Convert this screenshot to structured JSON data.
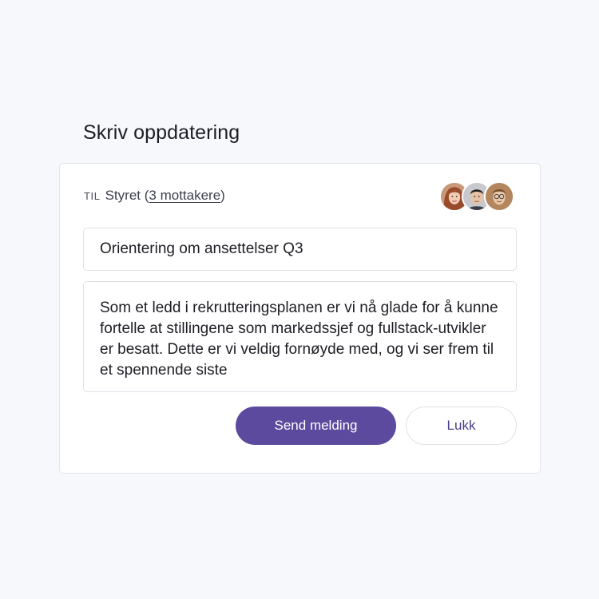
{
  "page": {
    "title": "Skriv oppdatering"
  },
  "recipients": {
    "prefix": "TIL",
    "group": "Styret",
    "open_paren": "(",
    "count_label": "3 mottakere",
    "close_paren": ")",
    "avatars": [
      "avatar-woman-red-hair",
      "avatar-man-dark-hair",
      "avatar-man-glasses"
    ]
  },
  "subject": {
    "value": "Orientering om ansettelser Q3"
  },
  "message": {
    "value": "Som et ledd i rekrutteringsplanen er vi nå glade for å kunne fortelle at stillingene som markedssjef og fullstack-utvikler er besatt. Dette er vi veldig fornøyde med, og vi ser frem til et spennende siste"
  },
  "actions": {
    "send_label": "Send melding",
    "close_label": "Lukk"
  },
  "colors": {
    "primary": "#5c4a9e",
    "background": "#f7f8fc",
    "card": "#ffffff",
    "border": "#e0e2e9"
  }
}
